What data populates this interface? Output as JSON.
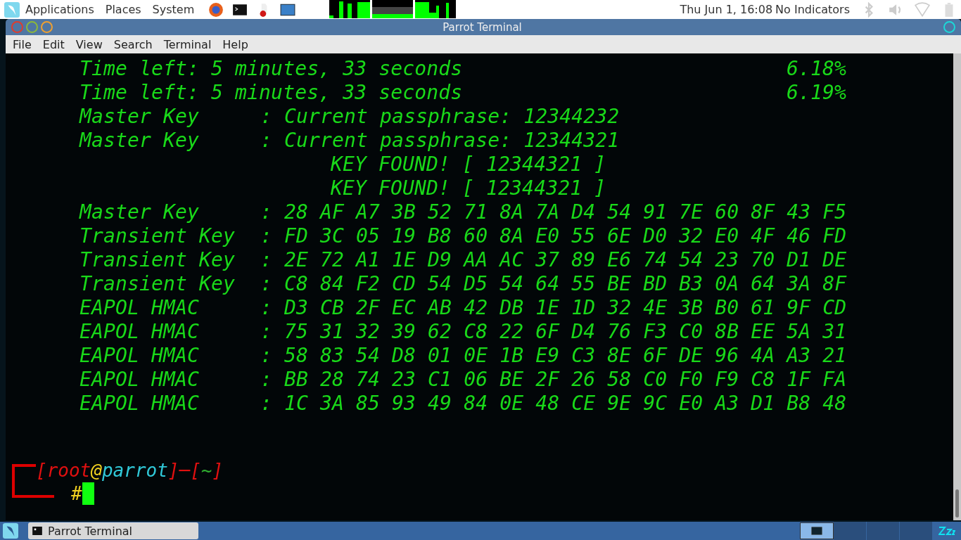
{
  "top_panel": {
    "menus": [
      "Applications",
      "Places",
      "System"
    ],
    "clock": "Thu Jun  1, 16:08",
    "indicators": "No Indicators"
  },
  "window": {
    "title": "Parrot Terminal"
  },
  "menubar": [
    "File",
    "Edit",
    "View",
    "Search",
    "Terminal",
    "Help"
  ],
  "terminal": {
    "lines": [
      {
        "kind": "progress",
        "text": "Time left: 5 minutes, 33 seconds",
        "percent": "6.18%"
      },
      {
        "kind": "progress",
        "text": "Time left: 5 minutes, 33 seconds",
        "percent": "6.19%"
      },
      {
        "kind": "key",
        "label": "Master Key",
        "value": ": Current passphrase: 12344232"
      },
      {
        "kind": "key",
        "label": "Master Key",
        "value": ": Current passphrase: 12344321"
      },
      {
        "kind": "found",
        "text": "KEY FOUND! [ 12344321 ]"
      },
      {
        "kind": "found",
        "text": "KEY FOUND! [ 12344321 ]"
      },
      {
        "kind": "key",
        "label": "Master Key",
        "value": ": 28 AF A7 3B 52 71 8A 7A D4 54 91 7E 60 8F 43 F5"
      },
      {
        "kind": "key",
        "label": "Transient Key",
        "value": ": FD 3C 05 19 B8 60 8A E0 55 6E D0 32 E0 4F 46 FD"
      },
      {
        "kind": "key",
        "label": "Transient Key",
        "value": ": 2E 72 A1 1E D9 AA AC 37 89 E6 74 54 23 70 D1 DE"
      },
      {
        "kind": "key",
        "label": "Transient Key",
        "value": ": C8 84 F2 CD 54 D5 54 64 55 BE BD B3 0A 64 3A 8F"
      },
      {
        "kind": "key",
        "label": "EAPOL HMAC",
        "value": ": D3 CB 2F EC AB 42 DB 1E 1D 32 4E 3B B0 61 9F CD"
      },
      {
        "kind": "key",
        "label": "EAPOL HMAC",
        "value": ": 75 31 32 39 62 C8 22 6F D4 76 F3 C0 8B EE 5A 31"
      },
      {
        "kind": "key",
        "label": "EAPOL HMAC",
        "value": ": 58 83 54 D8 01 0E 1B E9 C3 8E 6F DE 96 4A A3 21"
      },
      {
        "kind": "key",
        "label": "EAPOL HMAC",
        "value": ": BB 28 74 23 C1 06 BE 2F 26 58 C0 F0 F9 C8 1F FA"
      },
      {
        "kind": "key",
        "label": "EAPOL HMAC",
        "value": ": 1C 3A 85 93 49 84 0E 48 CE 9E 9C E0 A3 D1 B8 48"
      }
    ],
    "prompt": {
      "segments": [
        {
          "text": "[",
          "color": "#e01010"
        },
        {
          "text": "root",
          "color": "#e01010"
        },
        {
          "text": "@",
          "color": "#f0d020"
        },
        {
          "text": "parrot",
          "color": "#30c8d8"
        },
        {
          "text": "]",
          "color": "#e01010"
        },
        {
          "text": "─",
          "color": "#e01010"
        },
        {
          "text": "[",
          "color": "#e01010"
        },
        {
          "text": "~",
          "color": "#30b030"
        },
        {
          "text": "]",
          "color": "#e01010"
        }
      ],
      "symbol": "#"
    }
  },
  "taskbar": {
    "tasks": [
      {
        "label": "Parrot Terminal",
        "selected": false
      }
    ]
  }
}
